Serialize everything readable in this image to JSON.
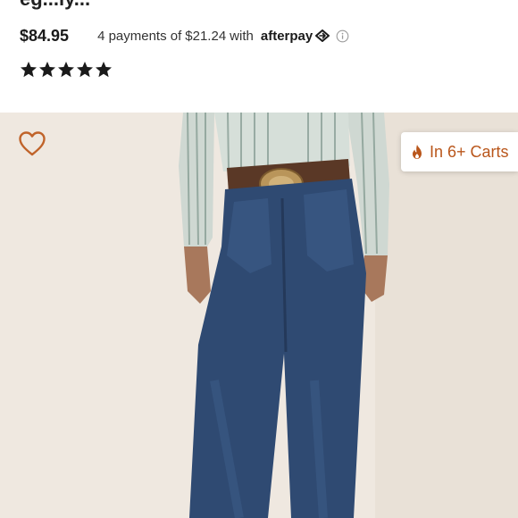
{
  "product": {
    "title_partial": "eg...ly...",
    "price": "$84.95",
    "installments": {
      "count_text": "4 payments of",
      "amount": "$21.24",
      "with_text": "with",
      "provider": "afterpay"
    },
    "rating": 5,
    "rating_max": 5
  },
  "image": {
    "badge_text": "In 6+ Carts",
    "badge_color": "#b9561b",
    "wishlist_color": "#c0632a"
  },
  "icons": {
    "wishlist": "heart-outline-icon",
    "badge": "fire-icon",
    "afterpay": "afterpay-arrows-icon",
    "info": "info-circle-icon",
    "rating": "star-icon"
  }
}
